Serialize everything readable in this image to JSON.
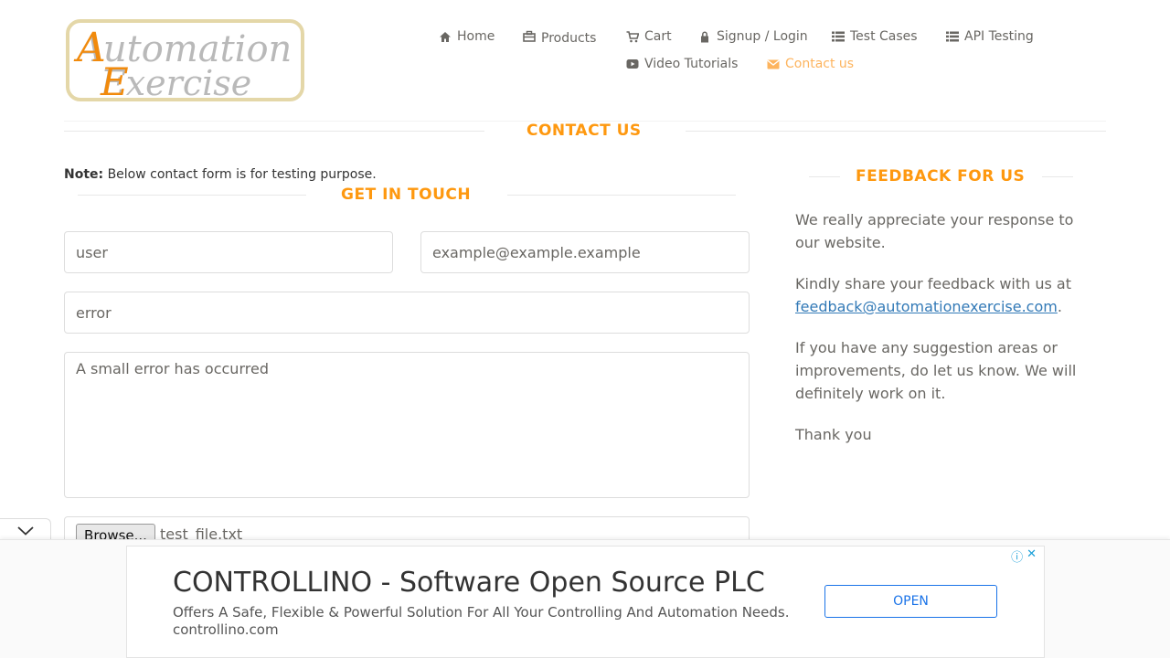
{
  "logo": {
    "line1": "Automation",
    "line2": "Exercise"
  },
  "nav": {
    "home": "Home",
    "products": "Products",
    "cart": "Cart",
    "signup": "Signup / Login",
    "test_cases": "Test Cases",
    "api_testing": "API Testing",
    "video_tutorials": "Video Tutorials",
    "contact": "Contact us"
  },
  "page_title": "CONTACT US",
  "note": {
    "label": "Note:",
    "text": "Below contact form is for testing purpose."
  },
  "form": {
    "title": "GET IN TOUCH",
    "name_value": "user",
    "email_value": "example@example.example",
    "subject_value": "error",
    "message_value": "A small error has occurred",
    "browse_label": "Browse...",
    "file_name": "test_file.txt"
  },
  "feedback": {
    "title": "FEEDBACK FOR US",
    "p1": "We really appreciate your response to our website.",
    "p2_prefix": "Kindly share your feedback with us at",
    "email": "feedback@automationexercise.com",
    "p2_suffix": ".",
    "p3": "If you have any suggestion areas or improvements, do let us know. We will definitely work on it.",
    "p4": "Thank you"
  },
  "ad": {
    "title": "CONTROLLINO - Software Open Source PLC",
    "description": "Offers A Safe, Flexible & Powerful Solution For All Your Controlling And Automation Needs.",
    "domain": "controllino.com",
    "cta": "OPEN"
  },
  "colors": {
    "accent": "#fe980f",
    "active_nav": "#fdb45e",
    "link": "#337ab7",
    "ad_blue": "#1a73e8"
  }
}
